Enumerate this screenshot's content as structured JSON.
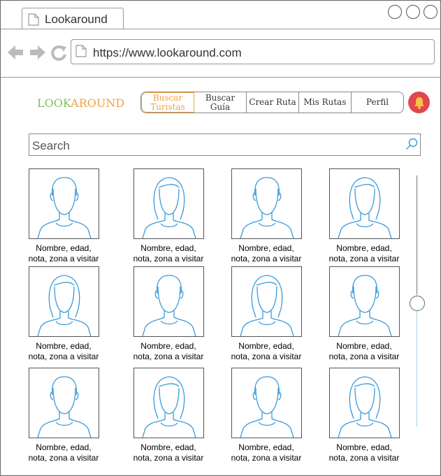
{
  "browser": {
    "tab_title": "Lookaround",
    "url": "https://www.lookaround.com"
  },
  "header": {
    "logo_part1": "LOOK",
    "logo_part2": "AROUND",
    "nav": [
      {
        "label": "Buscar Turistas",
        "active": true
      },
      {
        "label": "Buscar Guía",
        "active": false
      },
      {
        "label": "Crear Ruta",
        "active": false
      },
      {
        "label": "Mis Rutas",
        "active": false
      },
      {
        "label": "Perfil",
        "active": false
      }
    ],
    "bell_icon": "bell-icon"
  },
  "search": {
    "placeholder": "Search"
  },
  "cards": [
    {
      "line1": "Nombre, edad,",
      "line2": "nota, zona a visitar",
      "avatar": "male"
    },
    {
      "line1": "Nombre, edad,",
      "line2": "nota, zona a visitar",
      "avatar": "female"
    },
    {
      "line1": "Nombre, edad,",
      "line2": "nota, zona a visitar",
      "avatar": "male"
    },
    {
      "line1": "Nombre, edad,",
      "line2": "nota, zona a visitar",
      "avatar": "female"
    },
    {
      "line1": "Nombre, edad,",
      "line2": "nota, zona a visitar",
      "avatar": "female"
    },
    {
      "line1": "Nombre, edad,",
      "line2": "nota, zona a visitar",
      "avatar": "male"
    },
    {
      "line1": "Nombre, edad,",
      "line2": "nota, zona a visitar",
      "avatar": "female"
    },
    {
      "line1": "Nombre, edad,",
      "line2": "nota, zona a visitar",
      "avatar": "male"
    },
    {
      "line1": "Nombre, edad,",
      "line2": "nota, zona a visitar",
      "avatar": "male"
    },
    {
      "line1": "Nombre, edad,",
      "line2": "nota, zona a visitar",
      "avatar": "female"
    },
    {
      "line1": "Nombre, edad,",
      "line2": "nota, zona a visitar",
      "avatar": "male"
    },
    {
      "line1": "Nombre, edad,",
      "line2": "nota, zona a visitar",
      "avatar": "female"
    }
  ],
  "colors": {
    "accent": "#f0a33e",
    "logo_green": "#7fc35f",
    "avatar_stroke": "#3a9ad9",
    "bell_bg": "#e0474f"
  }
}
